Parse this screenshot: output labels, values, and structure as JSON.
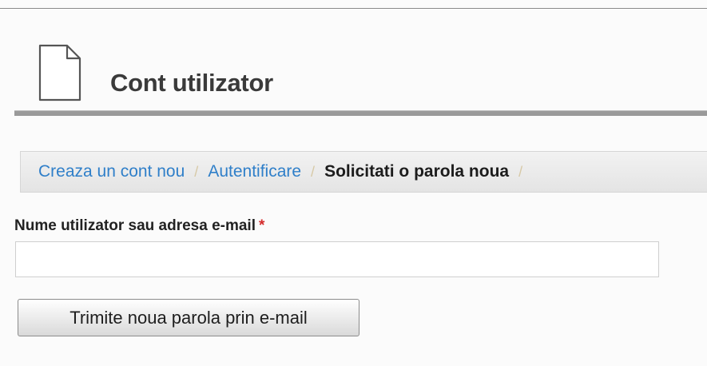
{
  "header": {
    "title": "Cont utilizator",
    "icon": "document-icon"
  },
  "tabs": [
    {
      "label": "Creaza un cont nou",
      "active": false
    },
    {
      "label": "Autentificare",
      "active": false
    },
    {
      "label": "Solicitati o parola noua",
      "active": true
    }
  ],
  "form": {
    "username_label": "Nume utilizator sau adresa e-mail",
    "required_marker": "*",
    "username_value": "",
    "submit_label": "Trimite noua parola prin e-mail"
  },
  "colors": {
    "link": "#2f7fc9",
    "required": "#d42b2b",
    "rule": "#9a9a9a"
  }
}
